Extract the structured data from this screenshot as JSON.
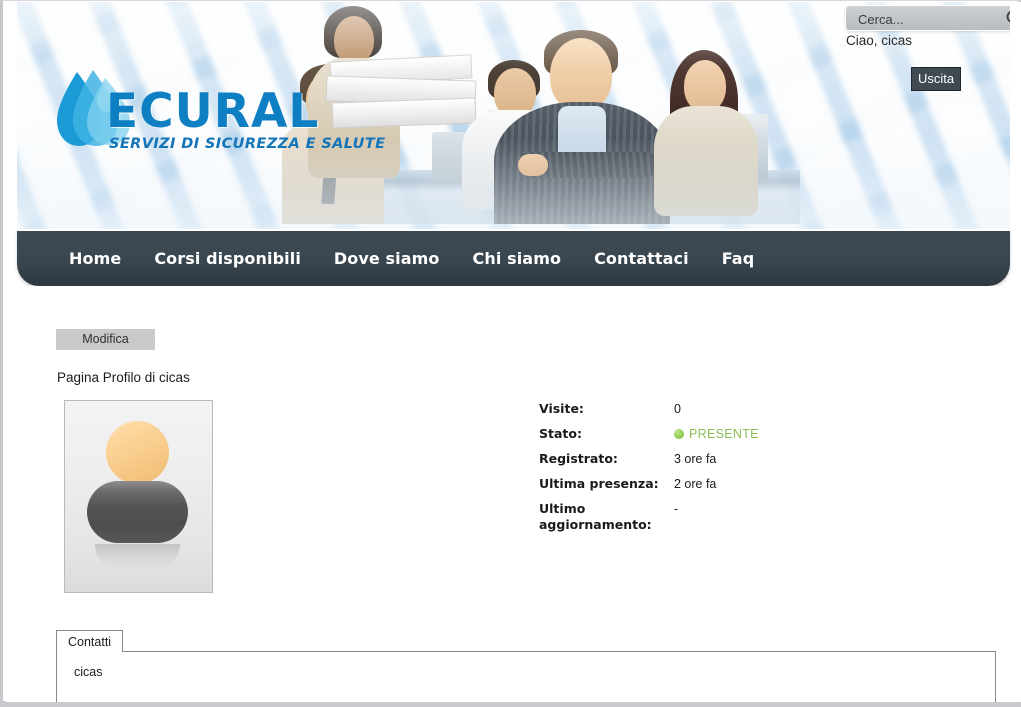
{
  "header": {
    "logo_text": "ECURAL",
    "logo_tagline": "SERVIZI DI SICUREZZA E SALUTE",
    "logo_icon": "water-drop-s-logo-icon"
  },
  "search": {
    "placeholder": "Cerca...",
    "value": "",
    "icon": "search-icon"
  },
  "user": {
    "greeting": "Ciao, cicas",
    "logout_label": "Uscita"
  },
  "nav": {
    "items": [
      {
        "label": "Home"
      },
      {
        "label": "Corsi disponibili"
      },
      {
        "label": "Dove siamo"
      },
      {
        "label": "Chi siamo"
      },
      {
        "label": "Contattaci"
      },
      {
        "label": "Faq"
      }
    ]
  },
  "main": {
    "edit_label": "Modifica",
    "profile_title": "Pagina Profilo di cicas",
    "avatar_icon": "default-user-avatar-icon",
    "info": [
      {
        "label": "Visite:",
        "value": "0",
        "status": false
      },
      {
        "label": "Stato:",
        "value": "PRESENTE",
        "status": true
      },
      {
        "label": "Registrato:",
        "value": "3 ore fa",
        "status": false
      },
      {
        "label": "Ultima presenza:",
        "value": "2 ore fa",
        "status": false
      },
      {
        "label": "Ultimo aggiornamento:",
        "value": "-",
        "status": false
      }
    ],
    "tabs": [
      {
        "label": "Contatti"
      }
    ],
    "tab_content": "cicas"
  },
  "colors": {
    "nav_bg": "#3b4852",
    "logo_blue": "#0f7fc4",
    "status_green": "#8bbd57",
    "logout_bg": "#3f4a52",
    "edit_bg": "#c9c9c9"
  }
}
